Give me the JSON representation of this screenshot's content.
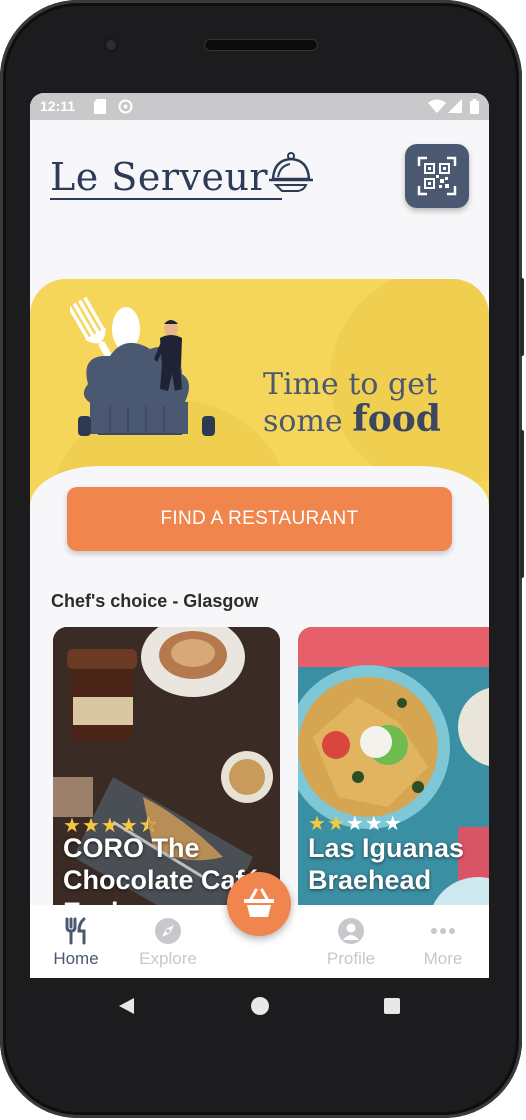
{
  "status_bar": {
    "time": "12:11"
  },
  "header": {
    "app_name": "Le Serveur"
  },
  "hero": {
    "line1": "Time to get",
    "line2_plain": "some ",
    "line2_bold": "food",
    "cta_label": "FIND A RESTAURANT"
  },
  "section": {
    "title": "Chef's choice - Glasgow"
  },
  "cards": [
    {
      "name": "CORO The Chocolate Café Exchange",
      "rating": 4.5
    },
    {
      "name": "Las Iguanas Braehead",
      "rating": 2
    }
  ],
  "bottom_nav": {
    "items": [
      {
        "label": "Home",
        "icon": "fork-knife-icon",
        "active": true
      },
      {
        "label": "Explore",
        "icon": "compass-icon",
        "active": false
      },
      {
        "label": "Profile",
        "icon": "person-icon",
        "active": false
      },
      {
        "label": "More",
        "icon": "more-icon",
        "active": false
      }
    ]
  },
  "colors": {
    "accent": "#f0854e",
    "hero_yellow": "#f6d65a",
    "navy": "#4b5872",
    "active_nav": "#4b5872",
    "inactive_nav": "#c7c7cc"
  }
}
